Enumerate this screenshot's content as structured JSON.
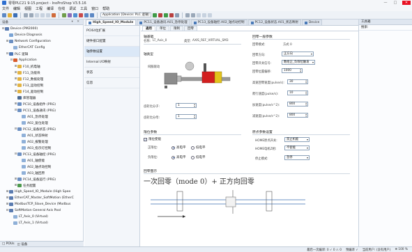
{
  "window": {
    "title": "零零PLC21 9-15.project - InoProShop V3.5.16",
    "controls": [
      "—",
      "□",
      "✕"
    ]
  },
  "menu": [
    "文件",
    "编辑",
    "视图",
    "工程",
    "编译",
    "在线",
    "调试",
    "工具",
    "窗口",
    "帮助"
  ],
  "toolbar": {
    "application_label": "Application [Device: PLC 逻辑]"
  },
  "left_panel": {
    "title": "设备",
    "icons": "▾ ✕",
    "tree": [
      {
        "indent": 0,
        "exp": "⊟",
        "icon": "#5a7bb0",
        "label": "Device (PM2000)"
      },
      {
        "indent": 1,
        "exp": "",
        "icon": "#7aa3d4",
        "label": "Device Diagnosis"
      },
      {
        "indent": 1,
        "exp": "⊞",
        "icon": "#6b8fc2",
        "label": "Network Configuration"
      },
      {
        "indent": 2,
        "exp": "",
        "icon": "#8fb0d8",
        "label": "EtherCAT Config"
      },
      {
        "indent": 1,
        "exp": "⊟",
        "icon": "#4d78b8",
        "label": "PLC 逻辑"
      },
      {
        "indent": 2,
        "exp": "⊟",
        "icon": "#d85a2a",
        "label": "Application"
      },
      {
        "indent": 3,
        "exp": "⊞",
        "icon": "#e3b341",
        "label": "F10_机电轴"
      },
      {
        "indent": 3,
        "exp": "⊞",
        "icon": "#e3b341",
        "label": "F11_功能块"
      },
      {
        "indent": 3,
        "exp": "⊞",
        "icon": "#e3b341",
        "label": "F12_数据处理"
      },
      {
        "indent": 3,
        "exp": "⊞",
        "icon": "#e3b341",
        "label": "F13_运动控制"
      },
      {
        "indent": 3,
        "exp": "⊞",
        "icon": "#e3b341",
        "label": "F14_驱动控制"
      },
      {
        "indent": 3,
        "exp": "",
        "icon": "#4c6a92",
        "label": "库管理器"
      },
      {
        "indent": 3,
        "exp": "⊞",
        "icon": "#6b8fc2",
        "label": "PC10_设备组件 (PRG)"
      },
      {
        "indent": 3,
        "exp": "⊟",
        "icon": "#6b8fc2",
        "label": "PC11_设备通讯 (PRG)"
      },
      {
        "indent": 4,
        "exp": "",
        "icon": "#8fb0d8",
        "label": "A01_急停处理"
      },
      {
        "indent": 4,
        "exp": "",
        "icon": "#8fb0d8",
        "label": "A02_复位处理"
      },
      {
        "indent": 3,
        "exp": "⊟",
        "icon": "#6b8fc2",
        "label": "PC12_设备状态 (PRG)"
      },
      {
        "indent": 4,
        "exp": "",
        "icon": "#8fb0d8",
        "label": "A01_状态映射"
      },
      {
        "indent": 4,
        "exp": "",
        "icon": "#8fb0d8",
        "label": "A02_报警处理"
      },
      {
        "indent": 4,
        "exp": "",
        "icon": "#8fb0d8",
        "label": "A03_指示灯控制"
      },
      {
        "indent": 3,
        "exp": "⊟",
        "icon": "#6b8fc2",
        "label": "PC13_设备轴控 (PRG)"
      },
      {
        "indent": 4,
        "exp": "",
        "icon": "#8fb0d8",
        "label": "A01_轴使能"
      },
      {
        "indent": 4,
        "exp": "",
        "icon": "#8fb0d8",
        "label": "A02_轴点动控制"
      },
      {
        "indent": 4,
        "exp": "",
        "icon": "#8fb0d8",
        "label": "A03_轴回原"
      },
      {
        "indent": 3,
        "exp": "⊞",
        "icon": "#6b8fc2",
        "label": "PC14_设备运行 (PRG)"
      },
      {
        "indent": 3,
        "exp": "⊞",
        "icon": "#4d9a4d",
        "label": "任务配置"
      },
      {
        "indent": 1,
        "exp": "⊞",
        "icon": "#5a7bb0",
        "label": "High_Speed_IO_Module (High Spee"
      },
      {
        "indent": 1,
        "exp": "⊞",
        "icon": "#5a7bb0",
        "label": "EtherCAT_Master_SoftMotion (EtherC"
      },
      {
        "indent": 1,
        "exp": "⊞",
        "icon": "#5a7bb0",
        "label": "ModbusTCP_Slave_Device (Modbus"
      },
      {
        "indent": 1,
        "exp": "⊟",
        "icon": "#5a7bb0",
        "label": "SoftMotion General Axis Pool"
      },
      {
        "indent": 2,
        "exp": "",
        "icon": "#8fb0d8",
        "label": "LT_Axis_0 (Virtual)"
      },
      {
        "indent": 2,
        "exp": "",
        "icon": "#8fb0d8",
        "label": "LT_Axis_1 (Virtual)"
      }
    ],
    "bottom_tabs": [
      "□ POUs",
      "◫ 设备"
    ]
  },
  "doc_tabs": [
    {
      "label": "High_Speed_IO_Module",
      "active": true
    },
    {
      "label": "PC11_设备通讯.A01_急停处理",
      "active": false
    },
    {
      "label": "PC13_设备轴控.A02_轴点动控制",
      "active": false
    },
    {
      "label": "PC12_设备状态.A01_状态映射",
      "active": false
    },
    {
      "label": "Device",
      "active": false
    }
  ],
  "side_nav": [
    "PCI64位扩展",
    "硬件接口配置",
    "轴参数设置",
    "Internal I/O映射",
    "状态",
    "信息"
  ],
  "sub_tabs": [
    "通用",
    "单位",
    "限制",
    "回零"
  ],
  "axis": {
    "section_title": "轴基础",
    "name_label": "名称:",
    "name_value": "LT_Axis_0",
    "type_label": "类型:",
    "type_value": "AXIS_REF_VIRTUAL_SM3",
    "axis_type_label": "轴类型",
    "axis_type_value": "线性轴",
    "image_caption": "伺服驱动",
    "gear_in_label": "齿轮比分子:",
    "gear_in_value": "1",
    "gear_out_label": "齿轮比分母:",
    "gear_out_value": "1"
  },
  "homing": {
    "section_title": "回零一般参数",
    "mode_label": "回零模式:",
    "mode_value": "方式 0",
    "dir_label": "回零方向:",
    "dir_value": "正方向",
    "start_label": "回零开关信号:",
    "start_value": "数组正_负限位触发",
    "offset_label": "回零位置偏移:",
    "offset_value": "1000",
    "high_speed_label": "高速回零速度(pulse/s):",
    "high_speed_value": "30",
    "low_speed_label": "爬行速度(pulse/s):",
    "low_speed_value": "10",
    "accel_label": "加速度(pulse/s^2):",
    "accel_value": "800",
    "decel_label": "减速度(pulse/s^2):",
    "decel_value": "800"
  },
  "limit": {
    "section_title": "限位参数",
    "enable_label": "限位使能",
    "forward_label": "正限位:",
    "reverse_label": "负限位:",
    "high_label": "高电平",
    "low_label": "低电平"
  },
  "origin": {
    "section_title": "原点参数设置",
    "signal_label": "HOME原点开关:",
    "signal_value": "禁止机能",
    "z_label": "HOME电机Z相:",
    "z_value": "不使能",
    "stop_label": "停止模式:",
    "stop_value": "急停"
  },
  "diagram": {
    "section_title": "回零图示",
    "caption": "一次回零（mode 0）+ 正方向回零"
  },
  "right_panel": {
    "title": "工具箱",
    "sub": "搜索:"
  },
  "status": [
    "最后一次编译: 0 ✓ 0 ⚠ 0",
    "预编译 ✓",
    "当前用户: (没有用户)",
    "⊕ 100 %"
  ]
}
